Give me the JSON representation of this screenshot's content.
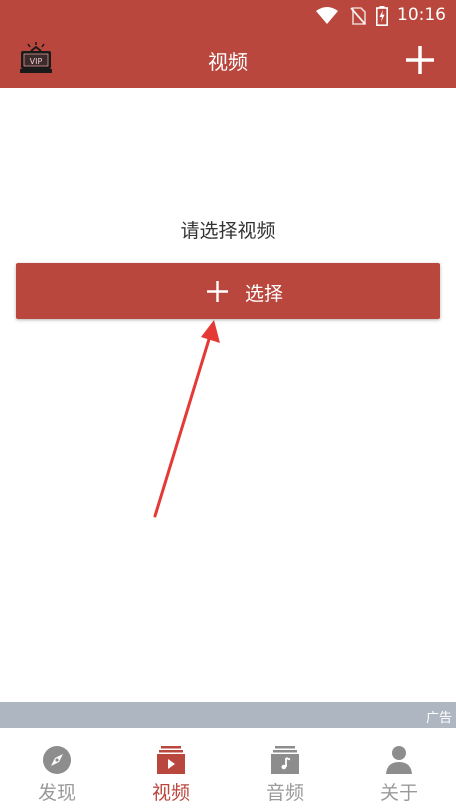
{
  "status": {
    "time": "10:16",
    "icons": [
      "wifi-icon",
      "no-sim-icon",
      "battery-charging-icon"
    ]
  },
  "appbar": {
    "title": "视频",
    "left_icon": "vip-icon",
    "right_icon": "add-icon"
  },
  "main": {
    "prompt": "请选择视频",
    "select_button_label": "选择"
  },
  "ad": {
    "label": "广告"
  },
  "bottom_nav": {
    "items": [
      {
        "label": "发现",
        "icon": "compass-icon",
        "active": false
      },
      {
        "label": "视频",
        "icon": "video-icon",
        "active": true
      },
      {
        "label": "音频",
        "icon": "music-icon",
        "active": false
      },
      {
        "label": "关于",
        "icon": "person-icon",
        "active": false
      }
    ]
  },
  "colors": {
    "accent": "#b9473d",
    "inactive": "#9a9a9a",
    "ad_strip": "#aeb6c2",
    "annotation_arrow": "#e53935"
  }
}
